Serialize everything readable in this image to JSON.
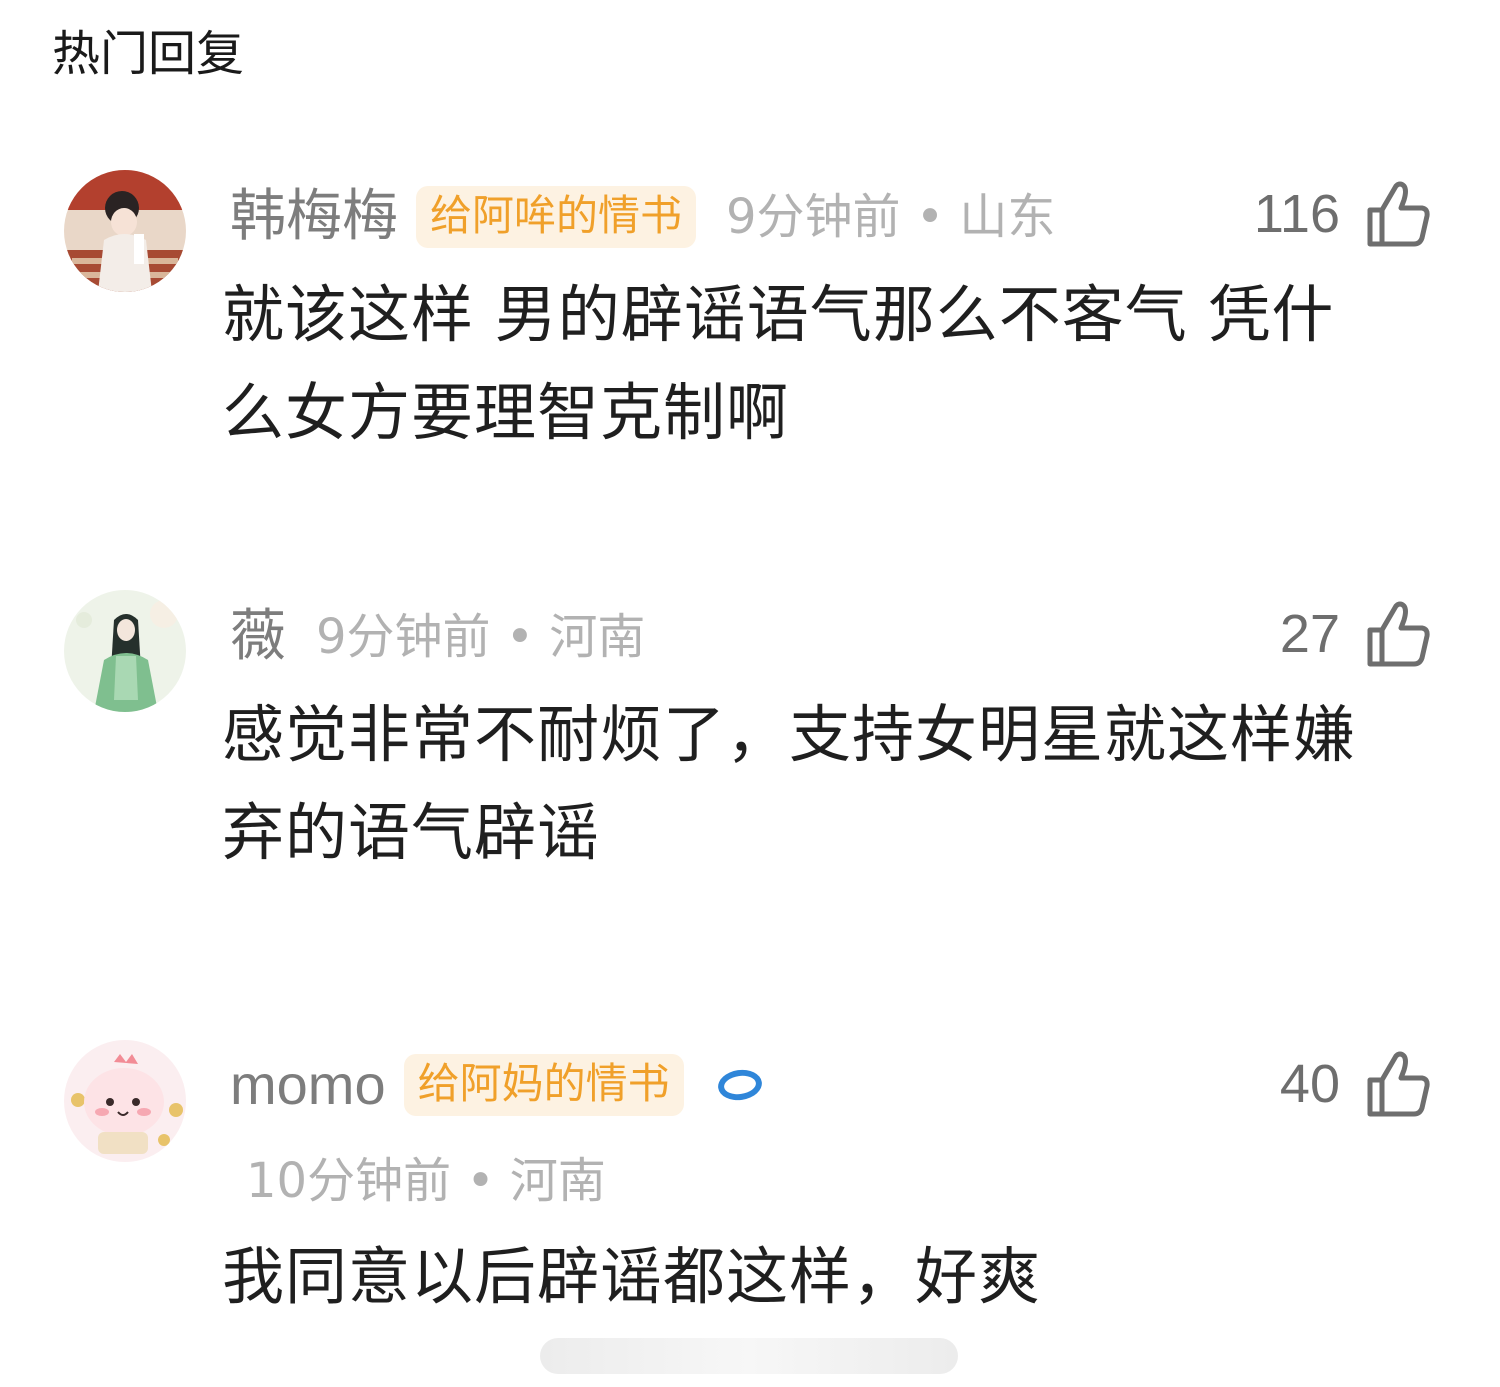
{
  "section_title": "热门回复",
  "comments": [
    {
      "username": "韩梅梅",
      "badge": "给阿哞的情书",
      "time_location": "9分钟前 • 山东",
      "likes": "116",
      "content_line1": "就该这样 男的辟谣语气那么不客气 凭什",
      "content_line2": "么女方要理智克制啊"
    },
    {
      "username": "薇",
      "time_location": "9分钟前 • 河南",
      "likes": "27",
      "content_line1": "感觉非常不耐烦了，支持女明星就这样嫌",
      "content_line2": "弃的语气辟谣"
    },
    {
      "username": "momo",
      "badge": "给阿妈的情书",
      "time_location": "10分钟前 • 河南",
      "likes": "40",
      "content_line1": "我同意以后辟谣都这样，好爽"
    }
  ],
  "icons": {
    "like": "thumbs-up-icon",
    "vip": "blue-ring-icon"
  },
  "colors": {
    "badge_text": "#f0a02a",
    "badge_bg": "#fdf2e2",
    "meta_gray": "#b2b2b2",
    "username_gray": "#7d7d7d",
    "vip_blue": "#2f86d9"
  }
}
